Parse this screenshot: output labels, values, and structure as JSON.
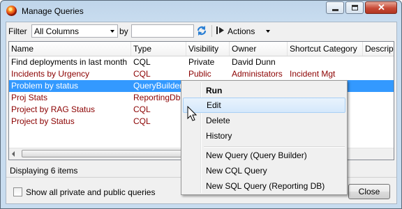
{
  "window": {
    "title": "Manage Queries"
  },
  "toolbar": {
    "filter_label": "Filter",
    "filter_value": "All Columns",
    "by_label": "by",
    "search_value": "",
    "actions_label": "Actions"
  },
  "columns": [
    "Name",
    "Type",
    "Visibility",
    "Owner",
    "Shortcut Category",
    "Description"
  ],
  "rows": [
    {
      "name": "Find deployments in last month",
      "type": "CQL",
      "visibility": "Private",
      "owner": "David Dunn",
      "category": "",
      "color": "#000000"
    },
    {
      "name": "Incidents by Urgency",
      "type": "CQL",
      "visibility": "Public",
      "owner": "Administators",
      "category": "Incident Mgt",
      "color": "#8b0000"
    },
    {
      "name": "Problem by status",
      "type": "QueryBuilder",
      "visibility": "",
      "owner": "",
      "category": "",
      "color": "#000000"
    },
    {
      "name": "Proj Stats",
      "type": "ReportingDb",
      "visibility": "",
      "owner": "",
      "category": "",
      "color": "#8b0000"
    },
    {
      "name": "Project by RAG Status",
      "type": "CQL",
      "visibility": "",
      "owner": "",
      "category": "",
      "color": "#8b0000"
    },
    {
      "name": "Project by Status",
      "type": "CQL",
      "visibility": "",
      "owner": "",
      "category": "",
      "color": "#8b0000"
    }
  ],
  "selected_row": 2,
  "status_text": "Displaying 6 items",
  "show_all_label": "Show all private and public queries",
  "show_all_checked": false,
  "close_label": "Close",
  "context_menu": {
    "items": [
      "Run",
      "Edit",
      "Delete",
      "History"
    ],
    "hovered": "Edit",
    "new_items": [
      "New Query (Query Builder)",
      "New CQL Query",
      "New SQL Query (Reporting DB)"
    ]
  }
}
